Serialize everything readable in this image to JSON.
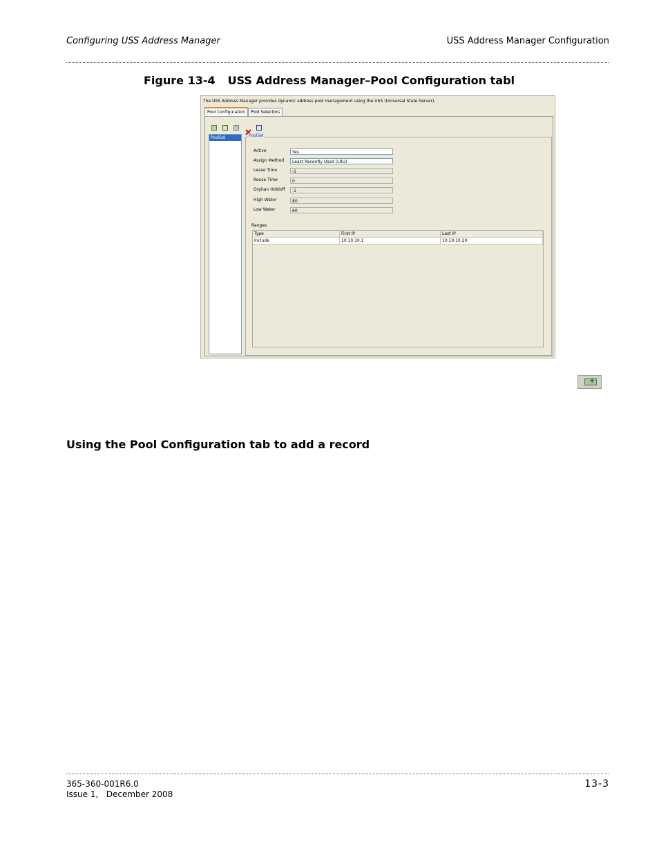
{
  "header": {
    "left": "Configuring USS Address Manager",
    "right": "USS Address Manager Configuration"
  },
  "figure": {
    "number": "Figure 13-4",
    "title": "USS Address Manager–Pool Configuration tabl"
  },
  "screenshot": {
    "description": "The USS Address Manager provides dynamic address pool management using the USS (Universal State Server).",
    "tabs": [
      "Pool Configuration",
      "Pool Selectors"
    ],
    "toolbar_icons": [
      "add-icon",
      "edit-icon",
      "copy-icon",
      "delete-icon",
      "info-icon"
    ],
    "list_items": [
      "PoolSel"
    ],
    "group_title": "PoolSel",
    "fields": [
      {
        "label": "Active",
        "value": "Yes"
      },
      {
        "label": "Assign Method",
        "value": "Least Recently Used (LRU)"
      },
      {
        "label": "Lease Time",
        "value": "-1"
      },
      {
        "label": "Reuse Time",
        "value": "0"
      },
      {
        "label": "Orphan Holdoff",
        "value": "-1"
      },
      {
        "label": "High Water",
        "value": "80"
      },
      {
        "label": "Low Water",
        "value": "60"
      }
    ],
    "ranges_label": "Ranges",
    "ranges_columns": [
      "Type",
      "First IP",
      "Last IP"
    ],
    "ranges_rows": [
      [
        "Include",
        "10.10.10.1",
        "10.10.10.20"
      ]
    ]
  },
  "add_button_icon": "add-record-icon",
  "section_heading": "Using the Pool Configuration tab to add a record",
  "footer": {
    "doc_number": "365-360-001R6.0",
    "issue": "Issue 1,   December 2008",
    "page": "13-3"
  }
}
